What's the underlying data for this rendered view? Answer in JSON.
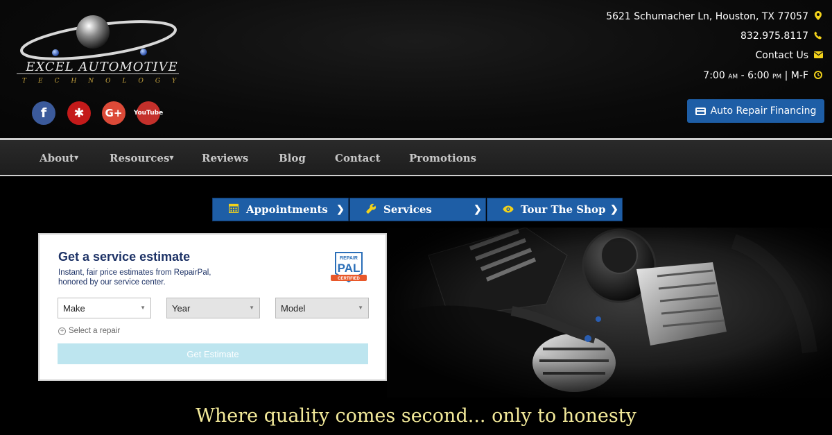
{
  "brand": {
    "name": "EXCEL AUTOMOTIVE",
    "tagline": "TECHNOLOGY"
  },
  "contact": {
    "address": "5621 Schumacher Ln, Houston, TX 77057",
    "phone": "832.975.8117",
    "contact_us": "Contact Us",
    "hours_open": "7:00",
    "am": "AM",
    "hours_close": "6:00",
    "pm": "PM",
    "days": "| M-F"
  },
  "social": [
    "facebook-icon",
    "yelp-icon",
    "google-plus-icon",
    "youtube-icon"
  ],
  "social_labels": {
    "google_plus": "G+",
    "youtube": "YouTube",
    "facebook": "f",
    "yelp": "✱"
  },
  "financing_button": "Auto Repair Financing",
  "nav": [
    {
      "label": "About",
      "dropdown": true
    },
    {
      "label": "Resources",
      "dropdown": true
    },
    {
      "label": "Reviews",
      "dropdown": false
    },
    {
      "label": "Blog",
      "dropdown": false
    },
    {
      "label": "Contact",
      "dropdown": false
    },
    {
      "label": "Promotions",
      "dropdown": false
    }
  ],
  "tabs": [
    {
      "label": "Appointments",
      "icon": "calendar-icon"
    },
    {
      "label": "Services",
      "icon": "wrench-icon"
    },
    {
      "label": "Tour The Shop",
      "icon": "eye-icon"
    }
  ],
  "estimate": {
    "title": "Get a service estimate",
    "subtitle": "Instant, fair price estimates from RepairPal, honored by our service center.",
    "badge_top": "REPAIR",
    "badge_mid": "PAL",
    "badge_bottom": "CERTIFIED",
    "make": "Make",
    "year": "Year",
    "model": "Model",
    "select_repair": "Select a repair",
    "button": "Get Estimate"
  },
  "hero_tagline": "Where quality comes second... only to honesty",
  "colors": {
    "accent_blue": "#1e5ea6",
    "icon_yellow": "#f2d21b",
    "tagline": "#f3ea9a",
    "widget_title": "#1d3266"
  }
}
